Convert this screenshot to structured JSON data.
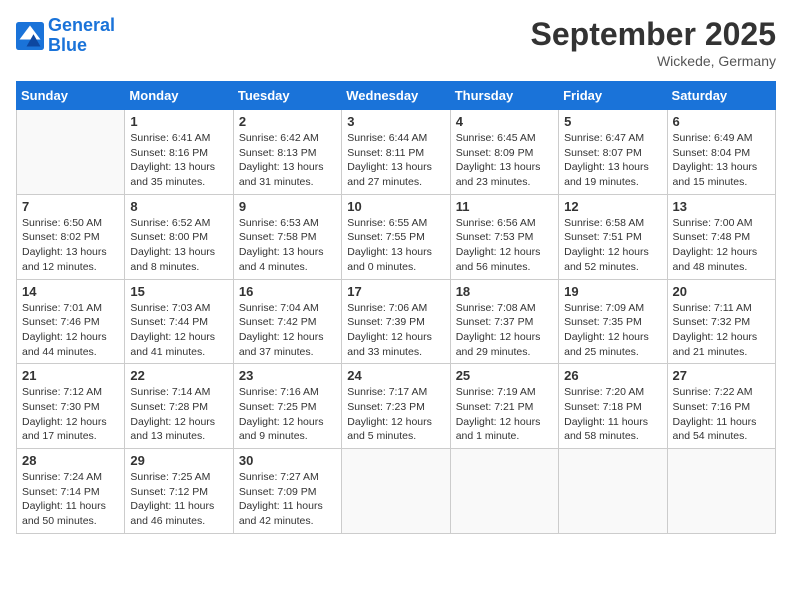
{
  "header": {
    "logo_line1": "General",
    "logo_line2": "Blue",
    "month_title": "September 2025",
    "location": "Wickede, Germany"
  },
  "days_of_week": [
    "Sunday",
    "Monday",
    "Tuesday",
    "Wednesday",
    "Thursday",
    "Friday",
    "Saturday"
  ],
  "weeks": [
    [
      {
        "num": "",
        "info": ""
      },
      {
        "num": "1",
        "info": "Sunrise: 6:41 AM\nSunset: 8:16 PM\nDaylight: 13 hours\nand 35 minutes."
      },
      {
        "num": "2",
        "info": "Sunrise: 6:42 AM\nSunset: 8:13 PM\nDaylight: 13 hours\nand 31 minutes."
      },
      {
        "num": "3",
        "info": "Sunrise: 6:44 AM\nSunset: 8:11 PM\nDaylight: 13 hours\nand 27 minutes."
      },
      {
        "num": "4",
        "info": "Sunrise: 6:45 AM\nSunset: 8:09 PM\nDaylight: 13 hours\nand 23 minutes."
      },
      {
        "num": "5",
        "info": "Sunrise: 6:47 AM\nSunset: 8:07 PM\nDaylight: 13 hours\nand 19 minutes."
      },
      {
        "num": "6",
        "info": "Sunrise: 6:49 AM\nSunset: 8:04 PM\nDaylight: 13 hours\nand 15 minutes."
      }
    ],
    [
      {
        "num": "7",
        "info": "Sunrise: 6:50 AM\nSunset: 8:02 PM\nDaylight: 13 hours\nand 12 minutes."
      },
      {
        "num": "8",
        "info": "Sunrise: 6:52 AM\nSunset: 8:00 PM\nDaylight: 13 hours\nand 8 minutes."
      },
      {
        "num": "9",
        "info": "Sunrise: 6:53 AM\nSunset: 7:58 PM\nDaylight: 13 hours\nand 4 minutes."
      },
      {
        "num": "10",
        "info": "Sunrise: 6:55 AM\nSunset: 7:55 PM\nDaylight: 13 hours\nand 0 minutes."
      },
      {
        "num": "11",
        "info": "Sunrise: 6:56 AM\nSunset: 7:53 PM\nDaylight: 12 hours\nand 56 minutes."
      },
      {
        "num": "12",
        "info": "Sunrise: 6:58 AM\nSunset: 7:51 PM\nDaylight: 12 hours\nand 52 minutes."
      },
      {
        "num": "13",
        "info": "Sunrise: 7:00 AM\nSunset: 7:48 PM\nDaylight: 12 hours\nand 48 minutes."
      }
    ],
    [
      {
        "num": "14",
        "info": "Sunrise: 7:01 AM\nSunset: 7:46 PM\nDaylight: 12 hours\nand 44 minutes."
      },
      {
        "num": "15",
        "info": "Sunrise: 7:03 AM\nSunset: 7:44 PM\nDaylight: 12 hours\nand 41 minutes."
      },
      {
        "num": "16",
        "info": "Sunrise: 7:04 AM\nSunset: 7:42 PM\nDaylight: 12 hours\nand 37 minutes."
      },
      {
        "num": "17",
        "info": "Sunrise: 7:06 AM\nSunset: 7:39 PM\nDaylight: 12 hours\nand 33 minutes."
      },
      {
        "num": "18",
        "info": "Sunrise: 7:08 AM\nSunset: 7:37 PM\nDaylight: 12 hours\nand 29 minutes."
      },
      {
        "num": "19",
        "info": "Sunrise: 7:09 AM\nSunset: 7:35 PM\nDaylight: 12 hours\nand 25 minutes."
      },
      {
        "num": "20",
        "info": "Sunrise: 7:11 AM\nSunset: 7:32 PM\nDaylight: 12 hours\nand 21 minutes."
      }
    ],
    [
      {
        "num": "21",
        "info": "Sunrise: 7:12 AM\nSunset: 7:30 PM\nDaylight: 12 hours\nand 17 minutes."
      },
      {
        "num": "22",
        "info": "Sunrise: 7:14 AM\nSunset: 7:28 PM\nDaylight: 12 hours\nand 13 minutes."
      },
      {
        "num": "23",
        "info": "Sunrise: 7:16 AM\nSunset: 7:25 PM\nDaylight: 12 hours\nand 9 minutes."
      },
      {
        "num": "24",
        "info": "Sunrise: 7:17 AM\nSunset: 7:23 PM\nDaylight: 12 hours\nand 5 minutes."
      },
      {
        "num": "25",
        "info": "Sunrise: 7:19 AM\nSunset: 7:21 PM\nDaylight: 12 hours\nand 1 minute."
      },
      {
        "num": "26",
        "info": "Sunrise: 7:20 AM\nSunset: 7:18 PM\nDaylight: 11 hours\nand 58 minutes."
      },
      {
        "num": "27",
        "info": "Sunrise: 7:22 AM\nSunset: 7:16 PM\nDaylight: 11 hours\nand 54 minutes."
      }
    ],
    [
      {
        "num": "28",
        "info": "Sunrise: 7:24 AM\nSunset: 7:14 PM\nDaylight: 11 hours\nand 50 minutes."
      },
      {
        "num": "29",
        "info": "Sunrise: 7:25 AM\nSunset: 7:12 PM\nDaylight: 11 hours\nand 46 minutes."
      },
      {
        "num": "30",
        "info": "Sunrise: 7:27 AM\nSunset: 7:09 PM\nDaylight: 11 hours\nand 42 minutes."
      },
      {
        "num": "",
        "info": ""
      },
      {
        "num": "",
        "info": ""
      },
      {
        "num": "",
        "info": ""
      },
      {
        "num": "",
        "info": ""
      }
    ]
  ]
}
